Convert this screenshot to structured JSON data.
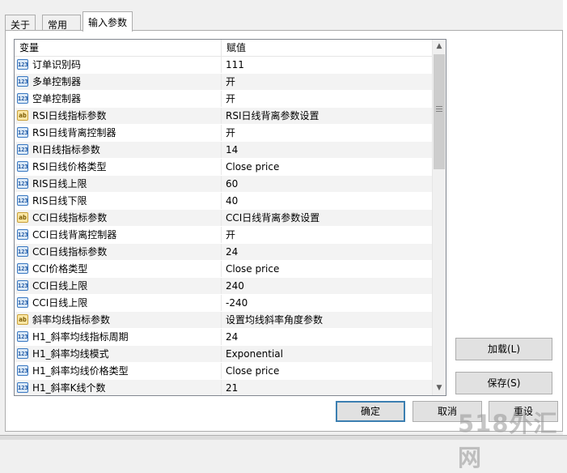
{
  "tabs": [
    {
      "label": "关于"
    },
    {
      "label": "常用"
    },
    {
      "label": "输入参数"
    }
  ],
  "grid": {
    "headers": {
      "variable": "变量",
      "value": "赋值"
    },
    "rows": [
      {
        "type": "num",
        "icon": "123",
        "name": "订单识别码",
        "value": "111"
      },
      {
        "type": "num",
        "icon": "123",
        "name": "多单控制器",
        "value": "开"
      },
      {
        "type": "num",
        "icon": "123",
        "name": "空单控制器",
        "value": "开"
      },
      {
        "type": "str",
        "icon": "ab",
        "name": "RSI日线指标参数",
        "value": "RSI日线背离参数设置"
      },
      {
        "type": "num",
        "icon": "123",
        "name": "RSI日线背离控制器",
        "value": "开"
      },
      {
        "type": "num",
        "icon": "123",
        "name": "RI日线指标参数",
        "value": "14"
      },
      {
        "type": "num",
        "icon": "123",
        "name": "RSI日线价格类型",
        "value": "Close price"
      },
      {
        "type": "num",
        "icon": "123",
        "name": "RIS日线上限",
        "value": "60"
      },
      {
        "type": "num",
        "icon": "123",
        "name": "RIS日线下限",
        "value": "40"
      },
      {
        "type": "str",
        "icon": "ab",
        "name": "CCI日线指标参数",
        "value": "CCI日线背离参数设置"
      },
      {
        "type": "num",
        "icon": "123",
        "name": "CCI日线背离控制器",
        "value": "开"
      },
      {
        "type": "num",
        "icon": "123",
        "name": "CCI日线指标参数",
        "value": "24"
      },
      {
        "type": "num",
        "icon": "123",
        "name": "CCI价格类型",
        "value": "Close price"
      },
      {
        "type": "num",
        "icon": "123",
        "name": "CCI日线上限",
        "value": "240"
      },
      {
        "type": "num",
        "icon": "123",
        "name": "CCI日线上限",
        "value": "-240"
      },
      {
        "type": "str",
        "icon": "ab",
        "name": "斜率均线指标参数",
        "value": "设置均线斜率角度参数"
      },
      {
        "type": "num",
        "icon": "123",
        "name": "H1_斜率均线指标周期",
        "value": "24"
      },
      {
        "type": "num",
        "icon": "123",
        "name": "H1_斜率均线模式",
        "value": "Exponential"
      },
      {
        "type": "num",
        "icon": "123",
        "name": "H1_斜率均线价格类型",
        "value": "Close price"
      },
      {
        "type": "num",
        "icon": "123",
        "name": "H1_斜率K线个数",
        "value": "21"
      }
    ]
  },
  "buttons": {
    "load": "加载(L)",
    "save": "保存(S)",
    "ok": "确定",
    "cancel": "取消",
    "reset": "重设"
  },
  "watermark": "518外汇网"
}
